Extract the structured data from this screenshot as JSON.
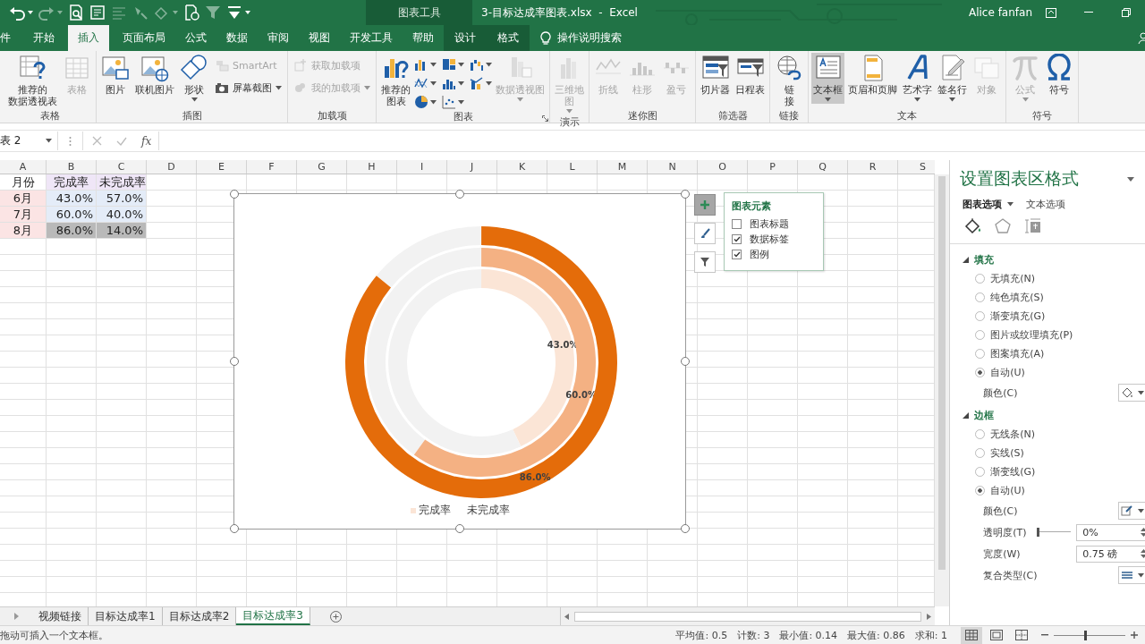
{
  "title_bar": {
    "quick_access": [
      {
        "disabled": false,
        "dropdown": true
      },
      {
        "disabled": true,
        "dropdown": true
      },
      {
        "disabled": false,
        "dropdown": false
      },
      {
        "disabled": false,
        "dropdown": false
      },
      {
        "disabled": true,
        "dropdown": false
      },
      {
        "disabled": true,
        "dropdown": false
      },
      {
        "disabled": true,
        "dropdown": true
      },
      {
        "disabled": false,
        "dropdown": false
      },
      {
        "disabled": true,
        "dropdown": false
      },
      {
        "disabled": false,
        "dropdown": true
      }
    ],
    "context_label": "图表工具",
    "title": "3-目标达成率图表.xlsx  -  Excel",
    "user": "Alice fanfan"
  },
  "tabs": [
    {
      "label": "件",
      "selected": false,
      "contextual": false
    },
    {
      "label": "开始",
      "selected": false,
      "contextual": false
    },
    {
      "label": "插入",
      "selected": true,
      "contextual": false
    },
    {
      "label": "页面布局",
      "selected": false,
      "contextual": false
    },
    {
      "label": "公式",
      "selected": false,
      "contextual": false
    },
    {
      "label": "数据",
      "selected": false,
      "contextual": false
    },
    {
      "label": "审阅",
      "selected": false,
      "contextual": false
    },
    {
      "label": "视图",
      "selected": false,
      "contextual": false
    },
    {
      "label": "开发工具",
      "selected": false,
      "contextual": false
    },
    {
      "label": "帮助",
      "selected": false,
      "contextual": false
    },
    {
      "label": "设计",
      "selected": false,
      "contextual": true
    },
    {
      "label": "格式",
      "selected": false,
      "contextual": true
    }
  ],
  "tell_me": {
    "label": "操作说明搜索"
  },
  "ribbon": {
    "groups": [
      {
        "label": "表格",
        "launcher": false,
        "items": [
          {
            "kind": "large",
            "lines": [
              "推荐的",
              "数据透视表"
            ],
            "disabled": false,
            "dropdown": false,
            "selected": false
          },
          {
            "kind": "large",
            "lines": [
              "表格"
            ],
            "disabled": true,
            "dropdown": false,
            "selected": false
          }
        ]
      },
      {
        "label": "插图",
        "launcher": false,
        "items": [
          {
            "kind": "large",
            "lines": [
              "图片"
            ],
            "disabled": false,
            "dropdown": false,
            "selected": false
          },
          {
            "kind": "large",
            "lines": [
              "联机图片"
            ],
            "disabled": false,
            "dropdown": false,
            "selected": false
          },
          {
            "kind": "large",
            "lines": [
              "形状"
            ],
            "disabled": false,
            "dropdown": true,
            "selected": false
          },
          {
            "kind": "small",
            "lines": [
              "SmartArt"
            ],
            "disabled": true,
            "dropdown": false,
            "selected": false
          },
          {
            "kind": "small",
            "lines": [
              "屏幕截图"
            ],
            "disabled": false,
            "dropdown": true,
            "selected": false
          }
        ]
      },
      {
        "label": "加载项",
        "launcher": false,
        "items": [
          {
            "kind": "small",
            "lines": [
              "获取加载项"
            ],
            "disabled": true,
            "dropdown": false,
            "selected": false
          },
          {
            "kind": "small",
            "lines": [
              "我的加载项"
            ],
            "disabled": true,
            "dropdown": true,
            "selected": false
          }
        ]
      },
      {
        "label": "图表",
        "launcher": true,
        "items": [
          {
            "kind": "large",
            "lines": [
              "推荐的",
              "图表"
            ],
            "disabled": false,
            "dropdown": false,
            "selected": false
          },
          {
            "kind": "gallery",
            "disabled": false,
            "dropdown": true,
            "selected": false
          },
          {
            "kind": "gallery",
            "disabled": false,
            "dropdown": true,
            "selected": false
          },
          {
            "kind": "gallery",
            "disabled": false,
            "dropdown": true,
            "selected": false
          },
          {
            "kind": "gallery",
            "disabled": false,
            "dropdown": true,
            "selected": false
          },
          {
            "kind": "gallery",
            "disabled": false,
            "dropdown": true,
            "selected": false
          },
          {
            "kind": "gallery",
            "disabled": false,
            "dropdown": true,
            "selected": false
          },
          {
            "kind": "gallery",
            "disabled": false,
            "dropdown": true,
            "selected": false
          },
          {
            "kind": "gallery",
            "disabled": false,
            "dropdown": true,
            "selected": false
          },
          {
            "kind": "large",
            "lines": [
              "数据透视图"
            ],
            "disabled": true,
            "dropdown": true,
            "selected": false
          }
        ]
      },
      {
        "label": "演示",
        "launcher": false,
        "items": [
          {
            "kind": "large",
            "lines": [
              "三维地",
              "图"
            ],
            "disabled": true,
            "dropdown": true,
            "selected": false
          }
        ]
      },
      {
        "label": "迷你图",
        "launcher": false,
        "items": [
          {
            "kind": "large",
            "lines": [
              "折线"
            ],
            "disabled": true,
            "dropdown": false,
            "selected": false
          },
          {
            "kind": "large",
            "lines": [
              "柱形"
            ],
            "disabled": true,
            "dropdown": false,
            "selected": false
          },
          {
            "kind": "large",
            "lines": [
              "盈亏"
            ],
            "disabled": true,
            "dropdown": false,
            "selected": false
          }
        ]
      },
      {
        "label": "筛选器",
        "launcher": false,
        "items": [
          {
            "kind": "large",
            "lines": [
              "切片器"
            ],
            "disabled": false,
            "dropdown": false,
            "selected": false
          },
          {
            "kind": "large",
            "lines": [
              "日程表"
            ],
            "disabled": false,
            "dropdown": false,
            "selected": false
          }
        ]
      },
      {
        "label": "链接",
        "launcher": false,
        "items": [
          {
            "kind": "large",
            "lines": [
              "链",
              "接"
            ],
            "disabled": false,
            "dropdown": false,
            "selected": false
          }
        ]
      },
      {
        "label": "文本",
        "launcher": false,
        "items": [
          {
            "kind": "large",
            "lines": [
              "文本框"
            ],
            "disabled": false,
            "dropdown": true,
            "selected": true
          },
          {
            "kind": "large",
            "lines": [
              "页眉和页脚"
            ],
            "disabled": false,
            "dropdown": false,
            "selected": false
          },
          {
            "kind": "large",
            "lines": [
              "艺术字"
            ],
            "disabled": false,
            "dropdown": true,
            "selected": false
          },
          {
            "kind": "large",
            "lines": [
              "签名行"
            ],
            "disabled": false,
            "dropdown": true,
            "selected": false
          },
          {
            "kind": "large",
            "lines": [
              "对象"
            ],
            "disabled": true,
            "dropdown": false,
            "selected": false
          }
        ]
      },
      {
        "label": "符号",
        "launcher": false,
        "items": [
          {
            "kind": "large",
            "lines": [
              "公式"
            ],
            "disabled": true,
            "dropdown": true,
            "selected": false
          },
          {
            "kind": "large",
            "lines": [
              "符号"
            ],
            "disabled": false,
            "dropdown": false,
            "selected": false
          }
        ]
      }
    ]
  },
  "formula_bar": {
    "name_box": "表 2",
    "fx": "fx"
  },
  "sheet": {
    "columns": [
      "A",
      "B",
      "C",
      "D",
      "E",
      "F",
      "G",
      "H",
      "I",
      "J",
      "K",
      "L",
      "M",
      "N",
      "O",
      "P",
      "Q",
      "R",
      "S"
    ],
    "rows": [
      {
        "cells": [
          {
            "text": "月份",
            "kind": "text",
            "selected": false
          },
          {
            "text": "完成率",
            "kind": "text",
            "color": "#efe6f7",
            "selected": false
          },
          {
            "text": "未完成率",
            "kind": "text",
            "color": "#efe6f7",
            "selected": false
          }
        ]
      },
      {
        "cells": [
          {
            "text": "6月",
            "kind": "text",
            "color": "#fbe4e4",
            "selected": false
          },
          {
            "text": "43.0%",
            "kind": "number",
            "color": "#e4ecf8",
            "selected": false
          },
          {
            "text": "57.0%",
            "kind": "number",
            "color": "#e4ecf8",
            "selected": false
          }
        ]
      },
      {
        "cells": [
          {
            "text": "7月",
            "kind": "text",
            "color": "#fbe4e4",
            "selected": false
          },
          {
            "text": "60.0%",
            "kind": "number",
            "color": "#e4ecf8",
            "selected": false
          },
          {
            "text": "40.0%",
            "kind": "number",
            "color": "#e4ecf8",
            "selected": false
          }
        ]
      },
      {
        "cells": [
          {
            "text": "8月",
            "kind": "text",
            "color": "#fbe4e4",
            "selected": false
          },
          {
            "text": "86.0%",
            "kind": "number",
            "selected": true
          },
          {
            "text": "14.0%",
            "kind": "number",
            "selected": true
          }
        ]
      }
    ]
  },
  "chart": {
    "chart_data": {
      "type": "donut",
      "categories": [
        "完成率",
        "未完成率"
      ],
      "series": [
        {
          "colors": [
            "#fbe5d6",
            "#f2f2f2"
          ],
          "values": [
            43.0,
            57.0
          ],
          "value_labels": [
            "43.0%",
            null
          ]
        },
        {
          "colors": [
            "#f4b183",
            "#f2f2f2"
          ],
          "values": [
            60.0,
            40.0
          ],
          "value_labels": [
            "60.0%",
            null
          ]
        },
        {
          "colors": [
            "#e46c0a",
            "#f2f2f2"
          ],
          "values": [
            86.0,
            14.0
          ],
          "value_labels": [
            "86.0%",
            null
          ]
        }
      ]
    },
    "side_buttons": [
      {
        "selected": true
      },
      {
        "selected": false
      },
      {
        "selected": false
      }
    ],
    "elements_popup": {
      "title": "图表元素",
      "items": [
        {
          "label": "图表标题",
          "checked": false
        },
        {
          "label": "数据标签",
          "checked": true
        },
        {
          "label": "图例",
          "checked": true
        }
      ]
    }
  },
  "format_pane": {
    "title": "设置图表区格式",
    "option_tabs": [
      {
        "label": "图表选项",
        "selected": true,
        "dropdown": true
      },
      {
        "label": "文本选项",
        "selected": false,
        "dropdown": false
      }
    ],
    "icon_tabs": [
      {
        "selected": true
      },
      {
        "selected": false
      },
      {
        "selected": false
      }
    ],
    "sections": [
      {
        "title": "填充",
        "expanded": true,
        "rows": [
          {
            "kind": "radio",
            "label": "无填充(N)",
            "selected": false
          },
          {
            "kind": "radio",
            "label": "纯色填充(S)",
            "selected": false
          },
          {
            "kind": "radio",
            "label": "渐变填充(G)",
            "selected": false
          },
          {
            "kind": "radio",
            "label": "图片或纹理填充(P)",
            "selected": false
          },
          {
            "kind": "radio",
            "label": "图案填充(A)",
            "selected": false
          },
          {
            "kind": "radio",
            "label": "自动(U)",
            "selected": true
          },
          {
            "kind": "color",
            "label": "颜色(C)"
          }
        ]
      },
      {
        "title": "边框",
        "expanded": true,
        "rows": [
          {
            "kind": "radio",
            "label": "无线条(N)",
            "selected": false
          },
          {
            "kind": "radio",
            "label": "实线(S)",
            "selected": false
          },
          {
            "kind": "radio",
            "label": "渐变线(G)",
            "selected": false
          },
          {
            "kind": "radio",
            "label": "自动(U)",
            "selected": true
          },
          {
            "kind": "color",
            "label": "颜色(C)"
          },
          {
            "kind": "slider",
            "label": "透明度(T)",
            "level": 0,
            "value": "0%"
          },
          {
            "kind": "spinner",
            "label": "宽度(W)",
            "value": "0.75 磅"
          },
          {
            "kind": "select",
            "label": "复合类型(C)"
          }
        ]
      }
    ]
  },
  "sheet_tabs": [
    {
      "label": "视频链接",
      "selected": false
    },
    {
      "label": "目标达成率1",
      "selected": false
    },
    {
      "label": "目标达成率2",
      "selected": false
    },
    {
      "label": "目标达成率3",
      "selected": true
    }
  ],
  "status_bar": {
    "message": "拖动可插入一个文本框。",
    "stats": [
      "平均值: 0.5",
      "计数: 3",
      "最小值: 0.14",
      "最大值: 0.86",
      "求和: 1"
    ],
    "views": [
      {
        "selected": true
      },
      {
        "selected": false
      },
      {
        "selected": false
      }
    ],
    "zoom": {
      "level": 0.42
    }
  }
}
